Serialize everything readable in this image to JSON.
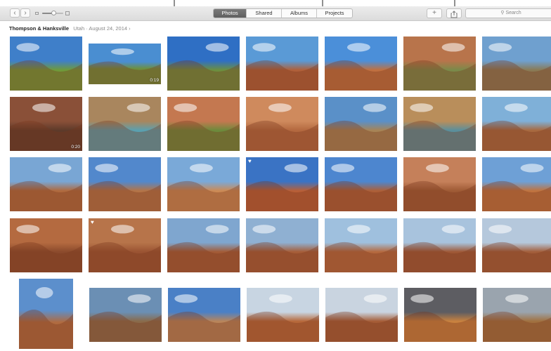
{
  "toolbar": {
    "back_glyph": "‹",
    "forward_glyph": "›",
    "zoom_level": 0.55,
    "tabs": [
      {
        "label": "Photos",
        "active": true
      },
      {
        "label": "Shared",
        "active": false
      },
      {
        "label": "Albums",
        "active": false
      },
      {
        "label": "Projects",
        "active": false
      }
    ],
    "add_glyph": "+",
    "search_placeholder": "Search"
  },
  "moment": {
    "location": "Thompson & Hanksville",
    "region": "Utah",
    "separator": "·",
    "date": "August 24, 2014",
    "chevron": "›"
  },
  "photos": [
    {
      "sky": "#3f7fc9",
      "ground": "#6f9a3a",
      "duration": "",
      "favorite": false
    },
    {
      "sky": "#4a8ed1",
      "ground": "#6e8f3d",
      "duration": "0:19",
      "favorite": false
    },
    {
      "sky": "#2f6fc4",
      "ground": "#6c8f3f",
      "duration": "",
      "favorite": false
    },
    {
      "sky": "#5a9ad6",
      "ground": "#b0603a",
      "duration": "",
      "favorite": false
    },
    {
      "sky": "#4b8fd9",
      "ground": "#c07040",
      "duration": "",
      "favorite": false
    },
    {
      "sky": "#b8744b",
      "ground": "#7a8a4a",
      "duration": "",
      "favorite": false
    },
    {
      "sky": "#6fa0cf",
      "ground": "#8a7a55",
      "duration": "",
      "favorite": false
    },
    {
      "sky": "#8a5038",
      "ground": "#5d3a2a",
      "duration": "0:20",
      "favorite": false
    },
    {
      "sky": "#a9865e",
      "ground": "#5aa0b0",
      "duration": "",
      "favorite": false
    },
    {
      "sky": "#c47850",
      "ground": "#6c8a3c",
      "duration": "",
      "favorite": false
    },
    {
      "sky": "#cf8a5d",
      "ground": "#b3683f",
      "duration": "",
      "favorite": false
    },
    {
      "sky": "#5a90c8",
      "ground": "#a78456",
      "duration": "",
      "favorite": false
    },
    {
      "sky": "#b98e5b",
      "ground": "#5a8f9c",
      "duration": "",
      "favorite": false
    },
    {
      "sky": "#7fb0d8",
      "ground": "#a8693f",
      "duration": "",
      "favorite": false
    },
    {
      "sky": "#79a6d4",
      "ground": "#b06a3e",
      "duration": "",
      "favorite": false
    },
    {
      "sky": "#5288cc",
      "ground": "#b47447",
      "duration": "",
      "favorite": false
    },
    {
      "sky": "#7aa9d8",
      "ground": "#cc8a55",
      "duration": "",
      "favorite": false
    },
    {
      "sky": "#3a73c4",
      "ground": "#b85f37",
      "duration": "",
      "favorite": true
    },
    {
      "sky": "#4d86cf",
      "ground": "#ad5f38",
      "duration": "",
      "favorite": false
    },
    {
      "sky": "#c5805a",
      "ground": "#9e5a35",
      "duration": "",
      "favorite": false
    },
    {
      "sky": "#6ea0d6",
      "ground": "#c0733f",
      "duration": "",
      "favorite": false
    },
    {
      "sky": "#b46a40",
      "ground": "#8b4a2c",
      "duration": "",
      "favorite": false
    },
    {
      "sky": "#b7744a",
      "ground": "#9a5332",
      "duration": "",
      "favorite": true
    },
    {
      "sky": "#7fa6cf",
      "ground": "#a35b36",
      "duration": "",
      "favorite": false
    },
    {
      "sky": "#8fb0d2",
      "ground": "#a65d38",
      "duration": "",
      "favorite": false
    },
    {
      "sky": "#9fc0de",
      "ground": "#b5693e",
      "duration": "",
      "favorite": false
    },
    {
      "sky": "#a8c3dd",
      "ground": "#9f5836",
      "duration": "",
      "favorite": false
    },
    {
      "sky": "#b5c8dc",
      "ground": "#a35e3a",
      "duration": "",
      "favorite": false
    },
    {
      "sky": "#5c8fcc",
      "ground": "#b06b40",
      "duration": "",
      "favorite": false
    },
    {
      "sky": "#6b8fb4",
      "ground": "#8a6a4a",
      "duration": "",
      "favorite": false
    },
    {
      "sky": "#4a80c6",
      "ground": "#b9855a",
      "duration": "",
      "favorite": false
    },
    {
      "sky": "#c8d5e2",
      "ground": "#b7683a",
      "duration": "",
      "favorite": false
    },
    {
      "sky": "#c9d4e0",
      "ground": "#a55c36",
      "duration": "",
      "favorite": false
    },
    {
      "sky": "#5d5d62",
      "ground": "#c9823f",
      "duration": "",
      "favorite": false
    },
    {
      "sky": "#9aa4ae",
      "ground": "#a1703f",
      "duration": "",
      "favorite": false
    }
  ]
}
